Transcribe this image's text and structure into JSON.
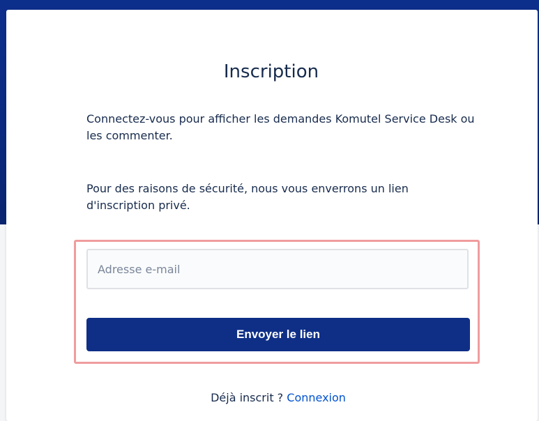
{
  "colors": {
    "brand_blue": "#0f2f87",
    "highlight": "#f09c9e",
    "link": "#0052cc"
  },
  "form": {
    "title": "Inscription",
    "intro": "Connectez-vous pour afficher les demandes Komutel Service Desk ou les commenter.",
    "security_note": "Pour des raisons de sécurité, nous vous enverrons un lien d'inscription privé.",
    "email_placeholder": "Adresse e-mail",
    "email_value": "",
    "submit_label": "Envoyer le lien"
  },
  "footer": {
    "prefix": "Déjà inscrit ?",
    "login_link": "Connexion"
  }
}
